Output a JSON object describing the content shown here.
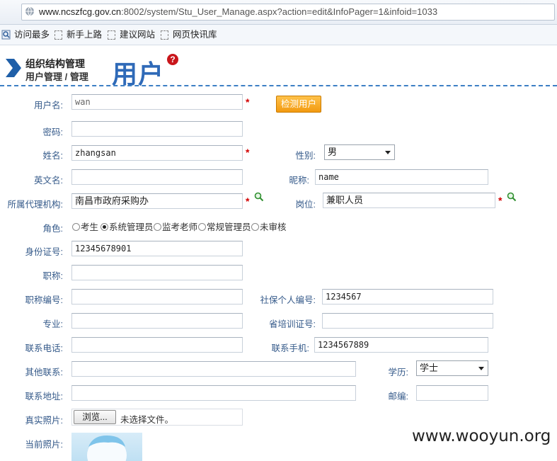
{
  "browser": {
    "url_host": "www.ncszfcg.gov.cn",
    "url_rest": ":8002/system/Stu_User_Manage.aspx?action=edit&InfoPager=1&infoid=1033",
    "favorites": [
      "访问最多",
      "新手上路",
      "建议网站",
      "网页快讯库"
    ]
  },
  "header": {
    "line1": "组织结构管理",
    "line2": "用户管理 / 管理",
    "big_title": "用户",
    "help_glyph": "?"
  },
  "form": {
    "username_label": "用户名:",
    "username_value": "wan",
    "check_button": "检测用户",
    "password_label": "密码:",
    "name_label": "姓名:",
    "name_value": "zhangsan",
    "gender_label": "性别:",
    "gender_value": "男",
    "english_name_label": "英文名:",
    "nickname_label": "昵称:",
    "nickname_value": "name",
    "org_label": "所属代理机构:",
    "org_value": "南昌市政府采购办",
    "post_label": "岗位:",
    "post_value": "兼职人员",
    "role_label": "角色:",
    "roles": [
      "考生",
      "系统管理员",
      "监考老师",
      "常规管理员",
      "未审核"
    ],
    "role_selected": "系统管理员",
    "id_label": "身份证号:",
    "id_value": "12345678901",
    "title_label": "职称:",
    "title_no_label": "职称编号:",
    "social_label": "社保个人编号:",
    "social_value": "1234567",
    "major_label": "专业:",
    "cert_label": "省培训证号:",
    "phone_label": "联系电话:",
    "mobile_label": "联系手机:",
    "mobile_value": "1234567889",
    "other_contact_label": "其他联系:",
    "education_label": "学历:",
    "education_value": "学士",
    "address_label": "联系地址:",
    "zip_label": "邮编:",
    "photo_label": "真实照片:",
    "browse_button": "浏览...",
    "file_status": "未选择文件。",
    "current_photo_label": "当前照片:"
  },
  "required_mark": "*",
  "watermark": "www.wooyun.org"
}
